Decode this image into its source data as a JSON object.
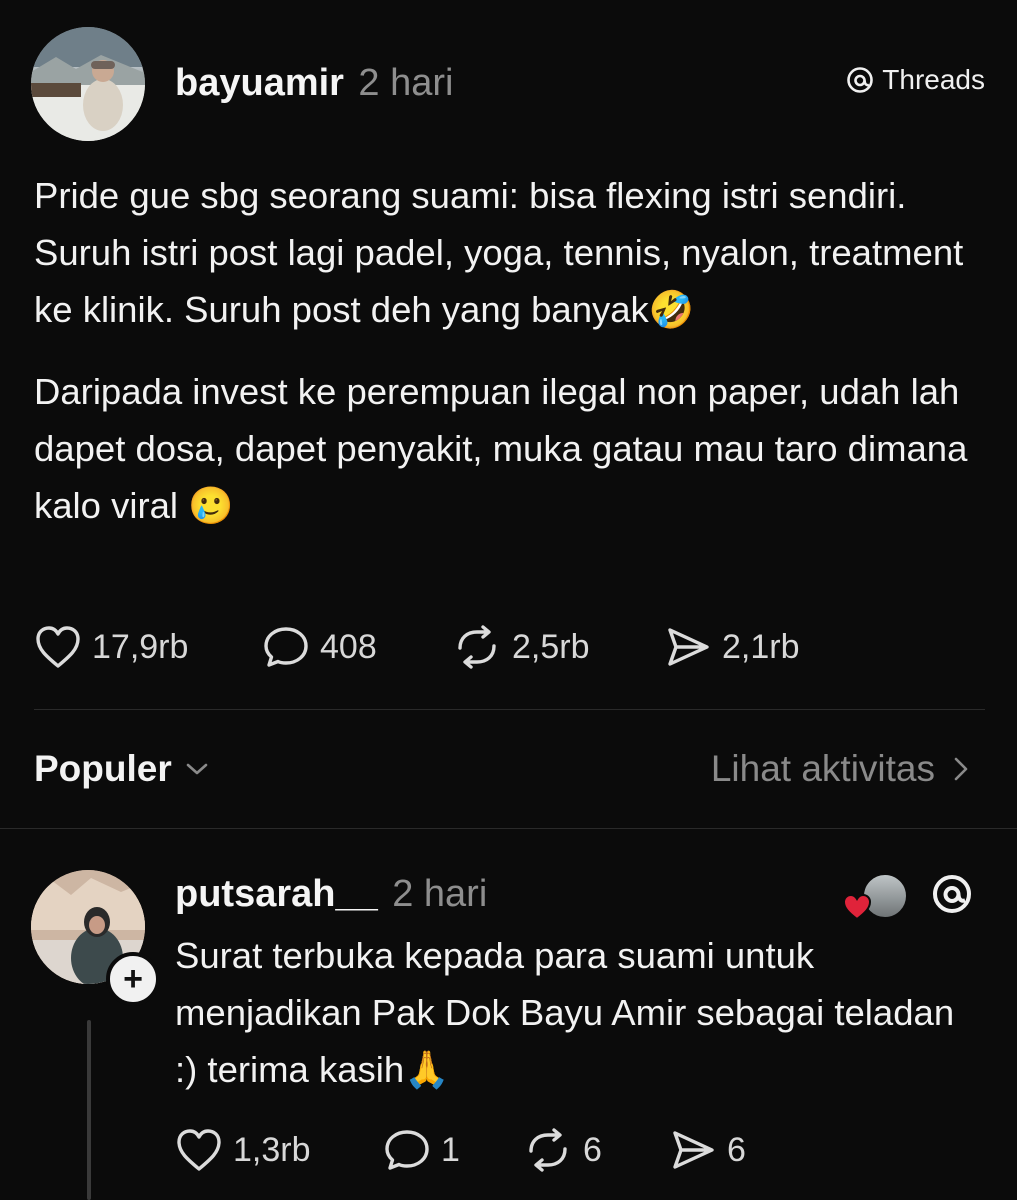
{
  "post": {
    "username": "bayuamir",
    "time": "2 hari",
    "brand": "Threads",
    "paragraphs": [
      "Pride gue sbg seorang suami: bisa flexing istri sendiri. Suruh istri post lagi padel, yoga, tennis, nyalon, treatment ke klinik. Suruh post deh yang banyak🤣",
      "Daripada invest ke perempuan ilegal non paper, udah lah dapet dosa, dapet penyakit, muka gatau mau taro dimana kalo viral 🥲"
    ],
    "stats": {
      "likes": "17,9rb",
      "replies": "408",
      "reposts": "2,5rb",
      "shares": "2,1rb"
    }
  },
  "section": {
    "sort_label": "Populer",
    "activity_label": "Lihat aktivitas"
  },
  "reply": {
    "username": "putsarah__",
    "time": "2 hari",
    "text": "Surat terbuka kepada para suami untuk menjadikan Pak Dok Bayu Amir sebagai teladan :) terima kasih🙏",
    "stats": {
      "likes": "1,3rb",
      "replies": "1",
      "reposts": "6",
      "shares": "6"
    },
    "follow_symbol": "+"
  },
  "icons": {
    "like": "heart-icon",
    "reply": "comment-icon",
    "repost": "repost-icon",
    "share": "send-icon",
    "brand": "threads-logo-icon",
    "chevron_down": "chevron-down-icon",
    "chevron_right": "chevron-right-icon"
  }
}
